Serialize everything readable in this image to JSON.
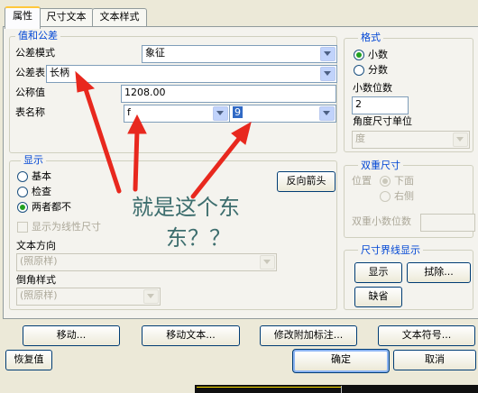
{
  "tabs": [
    {
      "label": "属性"
    },
    {
      "label": "尺寸文本"
    },
    {
      "label": "文本样式"
    }
  ],
  "value_tolerance": {
    "title": "值和公差",
    "tolerance_mode_label": "公差模式",
    "tolerance_mode_value": "象征",
    "tolerance_table_label": "公差表",
    "tolerance_table_value": "长柄",
    "nominal_value_label": "公称值",
    "nominal_value": "1208.00",
    "table_name_label": "表名称",
    "table_name_value_1": "f",
    "table_name_value_2": "9"
  },
  "format": {
    "title": "格式",
    "decimal_label": "小数",
    "fraction_label": "分数",
    "decimal_places_label": "小数位数",
    "decimal_places_value": "2",
    "angle_unit_label": "角度尺寸单位",
    "angle_unit_value": "度"
  },
  "display": {
    "title": "显示",
    "basic_label": "基本",
    "inspection_label": "检查",
    "both_label": "两者都不",
    "reverse_arrow_label": "反向箭头",
    "linear_dim_label": "显示为线性尺寸",
    "text_direction_label": "文本方向",
    "text_direction_value": "(照原样)",
    "chamfer_style_label": "倒角样式",
    "chamfer_style_value": "(照原样)"
  },
  "dual_dimension": {
    "title": "双重尺寸",
    "position_label": "位置",
    "below_label": "下面",
    "right_label": "右侧",
    "dual_decimal_label": "双重小数位数",
    "dual_decimal_value": ""
  },
  "witness_line": {
    "title": "尺寸界线显示",
    "show_label": "显示",
    "erase_label": "拭除...",
    "default_label": "缺省"
  },
  "actions": {
    "move": "移动...",
    "move_text": "移动文本...",
    "modify_attached_note": "修改附加标注...",
    "text_symbol": "文本符号...",
    "restore": "恢复值",
    "ok": "确定",
    "cancel": "取消"
  },
  "annotation": {
    "line1": "就是这个东",
    "line2": "东？？"
  },
  "colors": {
    "annotation_arrow": "#e8281e",
    "group_title": "#0046d5",
    "selection": "#316ac5"
  }
}
